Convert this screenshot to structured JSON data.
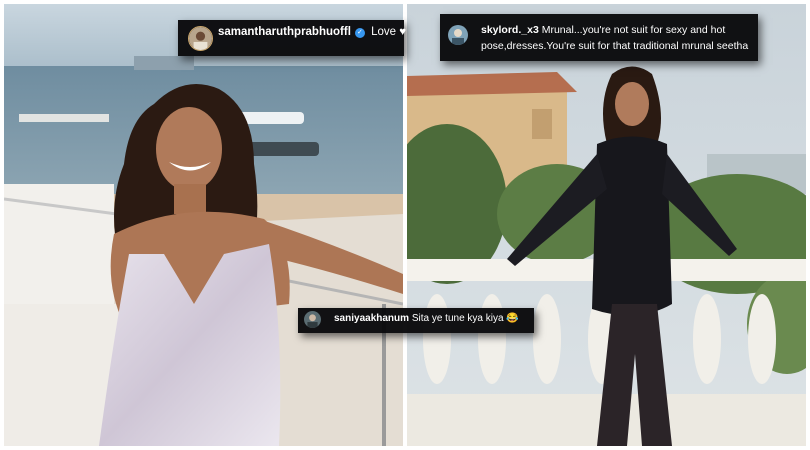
{
  "comments": [
    {
      "username": "samantharuthprabhuoffl",
      "verified_badge": "verified-check-icon",
      "text": "Love",
      "emoji": "♥"
    },
    {
      "username": "skylord._x3",
      "text_line1": "Mrunal...you're not suit for sexy and hot",
      "text_line2": "pose,dresses.You're suit for that traditional mrunal seetha"
    },
    {
      "username": "saniyaakhanum",
      "text": "Sita ye tune kya kiya",
      "emoji": "😂"
    }
  ],
  "colors": {
    "comment_bg": "#08080a",
    "verified": "#3797f0",
    "left_dress": "#d9d2dc",
    "right_outfit": "#141418"
  }
}
